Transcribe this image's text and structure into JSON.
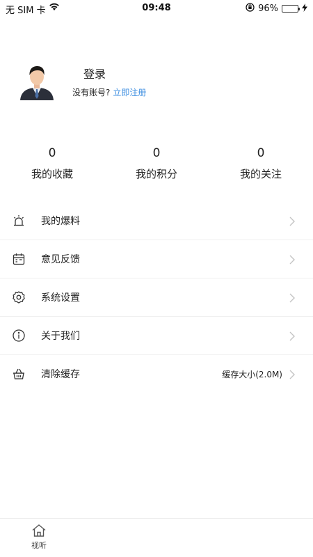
{
  "status_bar": {
    "carrier": "无 SIM 卡",
    "time": "09:48",
    "battery": "96%"
  },
  "profile": {
    "title": "登录",
    "prompt": "没有账号?",
    "signup_link": "立即注册"
  },
  "stats": [
    {
      "value": "0",
      "label": "我的收藏"
    },
    {
      "value": "0",
      "label": "我的积分"
    },
    {
      "value": "0",
      "label": "我的关注"
    }
  ],
  "menu": [
    {
      "label": "我的爆料",
      "icon": "siren-icon",
      "extra": ""
    },
    {
      "label": "意见反馈",
      "icon": "calendar-icon",
      "extra": ""
    },
    {
      "label": "系统设置",
      "icon": "gear-icon",
      "extra": ""
    },
    {
      "label": "关于我们",
      "icon": "info-icon",
      "extra": ""
    },
    {
      "label": "清除缓存",
      "icon": "basket-icon",
      "extra": "缓存大小(2.0M)"
    }
  ],
  "tabbar": {
    "tab": {
      "label": "视听",
      "icon": "home-icon"
    }
  },
  "colors": {
    "link": "#3b8de0",
    "battery": "#4cd964"
  }
}
